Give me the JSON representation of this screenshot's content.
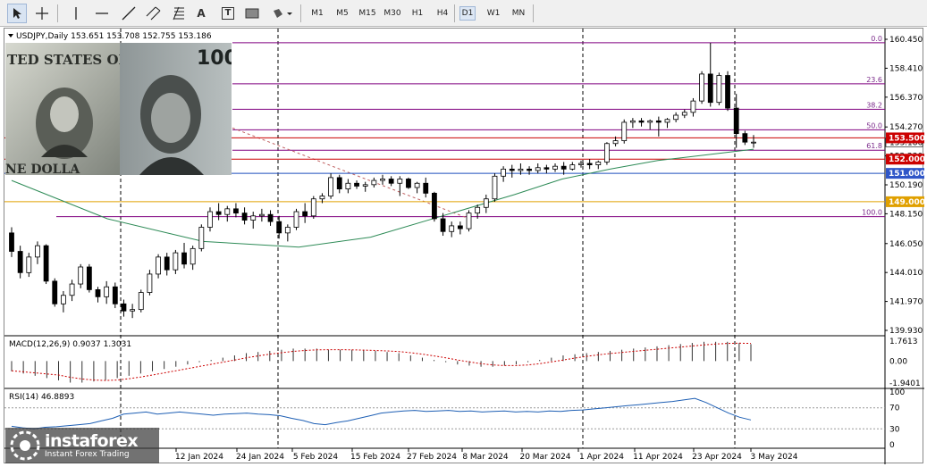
{
  "toolbar": {
    "tools": [
      {
        "name": "cursor-icon",
        "selected": true
      },
      {
        "name": "crosshair-icon",
        "selected": false
      },
      {
        "name": "vertical-line-icon",
        "selected": false
      },
      {
        "name": "horizontal-line-icon",
        "selected": false
      },
      {
        "name": "trendline-icon",
        "selected": false
      },
      {
        "name": "equidistant-channel-icon",
        "selected": false
      },
      {
        "name": "fibonacci-icon",
        "selected": false
      },
      {
        "name": "text-icon",
        "selected": false
      },
      {
        "name": "text-label-icon",
        "selected": false
      },
      {
        "name": "rectangle-icon",
        "selected": false
      },
      {
        "name": "shapes-menu-icon",
        "selected": false
      }
    ],
    "text_tool": "A",
    "label_tool": "T",
    "timeframes": [
      "M1",
      "M5",
      "M15",
      "M30",
      "H1",
      "H4",
      "D1",
      "W1",
      "MN"
    ],
    "selected_timeframe": "D1"
  },
  "chart": {
    "header": "USDJPY,Daily  153.651 153.708 152.755 153.186",
    "symbol_header_icon": "collapse-triangle-icon",
    "price_axis": [
      "160.450",
      "158.410",
      "156.370",
      "154.270",
      "152.230",
      "150.190",
      "148.150",
      "146.050",
      "144.010",
      "141.970",
      "139.930"
    ],
    "date_axis": [
      "12 Jan 2024",
      "24 Jan 2024",
      "5 Feb 2024",
      "15 Feb 2024",
      "27 Feb 2024",
      "8 Mar 2024",
      "20 Mar 2024",
      "1 Apr 2024",
      "11 Apr 2024",
      "23 Apr 2024",
      "3 May 2024"
    ],
    "current_price": "153.186",
    "price_tags": [
      {
        "text": "153.500",
        "price": 153.5,
        "color": "#cc0000"
      },
      {
        "text": "152.000",
        "price": 152.0,
        "color": "#cc0000"
      },
      {
        "text": "151.000",
        "price": 151.0,
        "color": "#2f56c8"
      },
      {
        "text": "149.000",
        "price": 149.0,
        "color": "#e0a000"
      }
    ],
    "fibonacci_levels": [
      {
        "label": "0.0",
        "price": 160.21
      },
      {
        "label": "23.6",
        "price": 157.31
      },
      {
        "label": "38.2",
        "price": 155.52
      },
      {
        "label": "50.0",
        "price": 154.07
      },
      {
        "label": "61.8",
        "price": 152.63
      },
      {
        "label": "100.0",
        "price": 147.95
      }
    ],
    "colors": {
      "bull": "#ffffff",
      "bear": "#000000",
      "moving_average": "#2e8b57",
      "fibonacci": "#800080",
      "red_level": "#cc0000",
      "blue_level": "#1f4ebd",
      "orange_level": "#e0a000",
      "grid_separator": "#000000"
    },
    "photo_text": {
      "dollar": "TED STATES OF A",
      "dollar_bottom": "NE DOLLA",
      "yen": "100"
    }
  },
  "macd": {
    "header": "MACD(12,26,9) 0.9037 1.3031",
    "axis": [
      "1.7613",
      "0.00",
      "-1.9401"
    ]
  },
  "rsi": {
    "header": "RSI(14) 46.8893",
    "axis": [
      "100",
      "70",
      "30",
      "0"
    ]
  },
  "watermark": {
    "brand": "instaforex",
    "tagline": "Instant Forex Trading"
  },
  "chart_data": {
    "type": "candlestick",
    "title": "USDJPY,Daily",
    "ylim": [
      139.93,
      160.45
    ],
    "x": [
      "12 Jan 2024",
      "24 Jan 2024",
      "5 Feb 2024",
      "15 Feb 2024",
      "27 Feb 2024",
      "8 Mar 2024",
      "20 Mar 2024",
      "1 Apr 2024",
      "11 Apr 2024",
      "23 Apr 2024",
      "3 May 2024"
    ],
    "ohlc": [
      [
        146.8,
        147.2,
        145.1,
        145.5
      ],
      [
        145.5,
        145.9,
        143.6,
        144.0
      ],
      [
        144.0,
        145.4,
        143.7,
        145.1
      ],
      [
        145.1,
        146.2,
        144.6,
        145.9
      ],
      [
        145.9,
        146.0,
        143.2,
        143.4
      ],
      [
        143.4,
        143.6,
        141.6,
        141.8
      ],
      [
        141.8,
        142.7,
        141.2,
        142.4
      ],
      [
        142.4,
        143.5,
        142.0,
        143.2
      ],
      [
        143.2,
        144.6,
        142.9,
        144.4
      ],
      [
        144.4,
        144.6,
        142.6,
        142.8
      ],
      [
        142.8,
        143.0,
        141.9,
        142.3
      ],
      [
        142.3,
        143.4,
        141.8,
        143.0
      ],
      [
        143.0,
        143.3,
        141.5,
        141.8
      ],
      [
        141.8,
        142.1,
        140.9,
        141.3
      ],
      [
        141.3,
        141.8,
        140.8,
        141.4
      ],
      [
        141.4,
        142.8,
        141.2,
        142.6
      ],
      [
        142.6,
        144.2,
        142.4,
        143.9
      ],
      [
        143.9,
        145.3,
        143.6,
        145.1
      ],
      [
        145.1,
        145.4,
        143.8,
        144.2
      ],
      [
        144.2,
        145.6,
        143.9,
        145.4
      ],
      [
        145.4,
        146.1,
        144.3,
        144.6
      ],
      [
        144.6,
        145.9,
        144.2,
        145.7
      ],
      [
        145.7,
        147.4,
        145.5,
        147.2
      ],
      [
        147.2,
        148.6,
        146.9,
        148.3
      ],
      [
        148.3,
        148.9,
        147.7,
        148.1
      ],
      [
        148.1,
        148.7,
        147.6,
        148.5
      ],
      [
        148.5,
        148.9,
        147.9,
        148.2
      ],
      [
        148.2,
        148.6,
        147.4,
        147.7
      ],
      [
        147.7,
        148.3,
        147.1,
        148.0
      ],
      [
        148.0,
        148.5,
        147.6,
        148.1
      ],
      [
        148.1,
        148.4,
        147.3,
        147.6
      ],
      [
        147.6,
        148.0,
        146.4,
        146.8
      ],
      [
        146.8,
        147.4,
        146.2,
        147.2
      ],
      [
        147.2,
        148.5,
        147.0,
        148.3
      ],
      [
        148.3,
        148.9,
        147.5,
        148.0
      ],
      [
        148.0,
        149.4,
        147.8,
        149.2
      ],
      [
        149.2,
        149.6,
        148.9,
        149.4
      ],
      [
        149.4,
        151.0,
        149.2,
        150.7
      ],
      [
        150.7,
        150.9,
        149.6,
        149.9
      ],
      [
        149.9,
        150.6,
        149.6,
        150.3
      ],
      [
        150.3,
        150.5,
        149.9,
        150.1
      ],
      [
        150.1,
        150.4,
        149.7,
        150.2
      ],
      [
        150.2,
        150.7,
        150.0,
        150.5
      ],
      [
        150.5,
        150.9,
        150.2,
        150.6
      ],
      [
        150.6,
        150.8,
        150.1,
        150.3
      ],
      [
        150.3,
        150.8,
        149.4,
        150.6
      ],
      [
        150.6,
        150.7,
        149.9,
        150.0
      ],
      [
        150.0,
        150.4,
        149.6,
        150.3
      ],
      [
        150.3,
        150.7,
        149.3,
        149.6
      ],
      [
        149.6,
        149.7,
        147.6,
        147.8
      ],
      [
        147.8,
        148.2,
        146.6,
        146.9
      ],
      [
        146.9,
        147.6,
        146.5,
        147.3
      ],
      [
        147.3,
        147.6,
        146.7,
        147.1
      ],
      [
        147.1,
        148.4,
        146.9,
        148.2
      ],
      [
        148.2,
        148.8,
        147.8,
        148.6
      ],
      [
        148.6,
        149.5,
        148.2,
        149.2
      ],
      [
        149.2,
        151.0,
        149.0,
        150.8
      ],
      [
        150.8,
        151.5,
        150.4,
        151.3
      ],
      [
        151.3,
        151.6,
        150.7,
        151.2
      ],
      [
        151.2,
        151.7,
        150.9,
        151.3
      ],
      [
        151.3,
        151.5,
        150.9,
        151.2
      ],
      [
        151.2,
        151.7,
        151.0,
        151.4
      ],
      [
        151.4,
        151.6,
        151.0,
        151.3
      ],
      [
        151.3,
        151.7,
        151.1,
        151.5
      ],
      [
        151.5,
        151.8,
        150.9,
        151.3
      ],
      [
        151.3,
        151.8,
        151.2,
        151.6
      ],
      [
        151.6,
        151.9,
        151.4,
        151.7
      ],
      [
        151.7,
        152.0,
        151.3,
        151.6
      ],
      [
        151.6,
        151.9,
        151.3,
        151.8
      ],
      [
        151.8,
        153.2,
        151.6,
        153.1
      ],
      [
        153.1,
        153.6,
        152.9,
        153.3
      ],
      [
        153.3,
        154.8,
        153.1,
        154.6
      ],
      [
        154.6,
        154.9,
        154.2,
        154.7
      ],
      [
        154.7,
        154.9,
        154.3,
        154.6
      ],
      [
        154.6,
        154.8,
        154.1,
        154.7
      ],
      [
        154.7,
        155.0,
        153.6,
        154.6
      ],
      [
        154.6,
        154.9,
        154.2,
        154.8
      ],
      [
        154.8,
        155.3,
        154.6,
        155.1
      ],
      [
        155.1,
        155.5,
        154.9,
        155.3
      ],
      [
        155.3,
        156.3,
        155.0,
        156.1
      ],
      [
        156.1,
        158.2,
        155.9,
        158.0
      ],
      [
        158.0,
        160.2,
        155.7,
        156.0
      ],
      [
        156.0,
        158.1,
        155.8,
        157.9
      ],
      [
        157.9,
        158.2,
        155.4,
        155.6
      ],
      [
        155.6,
        156.6,
        152.8,
        153.8
      ],
      [
        153.8,
        154.0,
        153.0,
        153.2
      ],
      [
        153.2,
        153.7,
        152.8,
        153.2
      ]
    ],
    "moving_average": [
      [
        0,
        150.5
      ],
      [
        20,
        147.8
      ],
      [
        40,
        146.2
      ],
      [
        60,
        145.8
      ],
      [
        75,
        146.5
      ],
      [
        90,
        148.0
      ],
      [
        105,
        149.5
      ],
      [
        115,
        150.6
      ],
      [
        125,
        151.3
      ],
      [
        135,
        151.9
      ],
      [
        145,
        152.3
      ],
      [
        155,
        152.7
      ]
    ],
    "macd": {
      "series": "histogram",
      "values": [
        -0.9,
        -1.1,
        -1.3,
        -1.5,
        -1.7,
        -1.9,
        -1.9,
        -1.8,
        -1.7,
        -1.5,
        -1.3,
        -1.1,
        -0.9,
        -0.7,
        -0.5,
        -0.3,
        -0.1,
        0.1,
        0.3,
        0.5,
        0.7,
        0.8,
        0.9,
        1.0,
        1.1,
        1.1,
        1.1,
        1.0,
        1.0,
        1.0,
        1.0,
        0.9,
        0.8,
        0.7,
        0.5,
        0.3,
        0.1,
        -0.1,
        -0.3,
        -0.4,
        -0.5,
        -0.5,
        -0.4,
        -0.3,
        -0.1,
        0.1,
        0.3,
        0.5,
        0.6,
        0.7,
        0.8,
        0.9,
        1.0,
        1.1,
        1.2,
        1.3,
        1.4,
        1.5,
        1.6,
        1.7,
        1.7,
        1.7,
        1.6,
        1.5
      ],
      "ylim": [
        -1.9401,
        1.7613
      ]
    },
    "rsi": {
      "values": [
        35,
        32,
        30,
        33,
        34,
        36,
        38,
        40,
        45,
        50,
        58,
        60,
        62,
        58,
        60,
        62,
        60,
        58,
        56,
        58,
        59,
        60,
        58,
        57,
        55,
        50,
        46,
        40,
        38,
        42,
        45,
        50,
        55,
        60,
        62,
        64,
        65,
        63,
        64,
        65,
        63,
        64,
        62,
        63,
        64,
        62,
        63,
        62,
        64,
        63,
        65,
        66,
        68,
        70,
        72,
        74,
        76,
        78,
        80,
        82,
        85,
        88,
        80,
        70,
        60,
        52,
        46.9
      ],
      "ylim": [
        0,
        100
      ]
    }
  }
}
